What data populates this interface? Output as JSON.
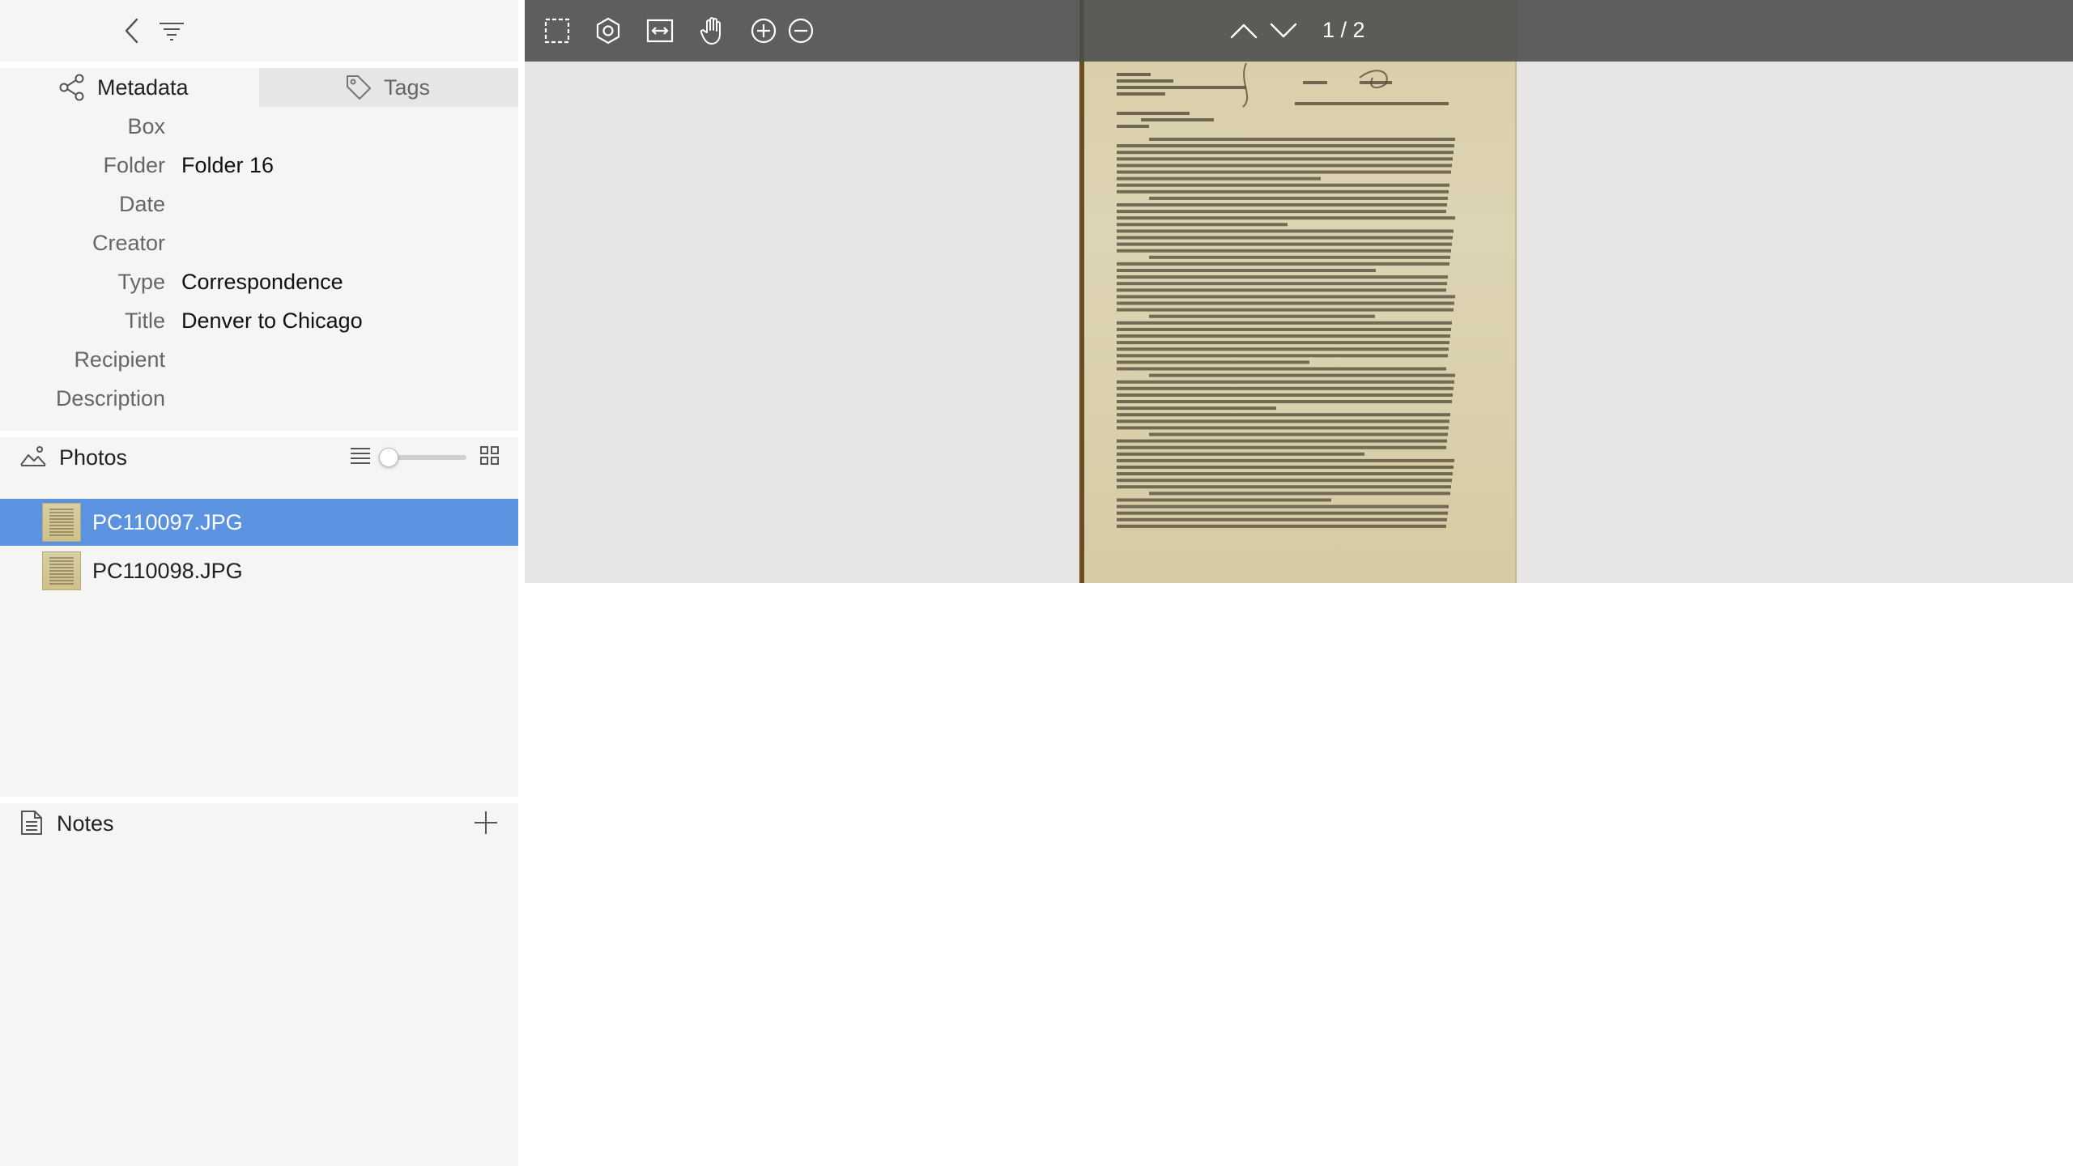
{
  "sidebar": {
    "tabs": {
      "metadata_label": "Metadata",
      "tags_label": "Tags"
    },
    "metadata_fields": [
      {
        "label": "Box",
        "value": ""
      },
      {
        "label": "Folder",
        "value": "Folder 16"
      },
      {
        "label": "Date",
        "value": ""
      },
      {
        "label": "Creator",
        "value": ""
      },
      {
        "label": "Type",
        "value": "Correspondence"
      },
      {
        "label": "Title",
        "value": "Denver to Chicago"
      },
      {
        "label": "Recipient",
        "value": ""
      },
      {
        "label": "Description",
        "value": ""
      }
    ],
    "photos": {
      "title": "Photos",
      "thumbnail_size": 0,
      "items": [
        {
          "name": "PC110097.JPG",
          "selected": true
        },
        {
          "name": "PC110098.JPG",
          "selected": false
        }
      ]
    },
    "notes": {
      "title": "Notes"
    }
  },
  "viewer": {
    "page_indicator": "1 / 2"
  },
  "colors": {
    "selection": "#5b93e0",
    "sidebar_bg": "#f5f5f5",
    "viewer_bg": "#e6e6e6",
    "toolbar_bg": "#4b4b4b",
    "paper": "#ddd4b4"
  },
  "icons": {
    "toolbar": [
      "select-rect-icon",
      "adjust-icon",
      "fit-width-icon",
      "hand-icon",
      "zoom-in-icon",
      "zoom-out-icon",
      "page-up-icon",
      "page-down-icon"
    ],
    "sidebar": [
      "back-icon",
      "filter-icon",
      "share-icon",
      "tag-icon",
      "photos-icon",
      "list-view-icon",
      "grid-view-icon",
      "notes-icon",
      "plus-icon"
    ]
  }
}
